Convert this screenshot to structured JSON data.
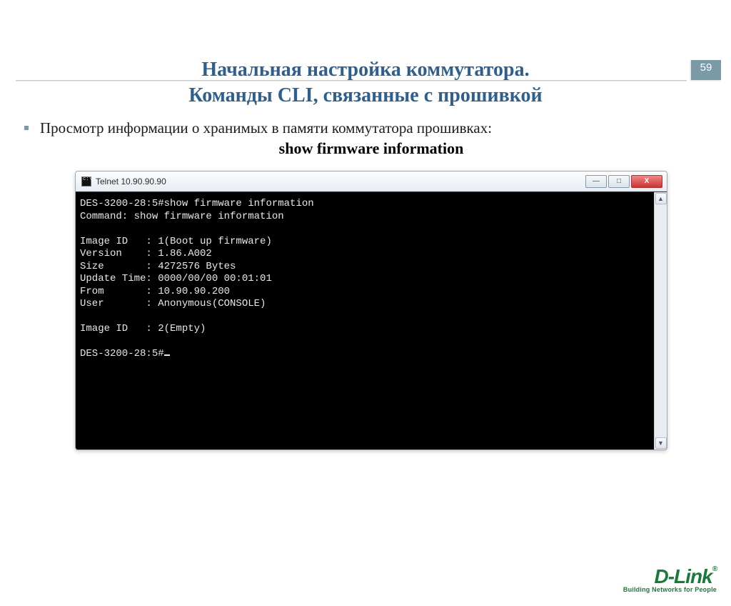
{
  "page_number": "59",
  "title_line1": "Начальная настройка коммутатора.",
  "title_line2": "Команды CLI, связанные с прошивкой",
  "bullet_text": "Просмотр информации о хранимых в памяти коммутатора прошивках:",
  "command": "show firmware information",
  "terminal": {
    "window_title": "Telnet 10.90.90.90",
    "lines": {
      "l1": "DES-3200-28:5#show firmware information",
      "l2": "Command: show firmware information",
      "blank1": "",
      "l3": "Image ID   : 1(Boot up firmware)",
      "l4": "Version    : 1.86.A002",
      "l5": "Size       : 4272576 Bytes",
      "l6": "Update Time: 0000/00/00 00:01:01",
      "l7": "From       : 10.90.90.200",
      "l8": "User       : Anonymous(CONSOLE)",
      "blank2": "",
      "l9": "Image ID   : 2(Empty)",
      "blank3": "",
      "prompt": "DES-3200-28:5#"
    }
  },
  "window_controls": {
    "minimize": "—",
    "maximize": "□",
    "close": "X"
  },
  "scroll": {
    "up": "▲",
    "down": "▼"
  },
  "brand": {
    "name": "D-Link",
    "reg": "®",
    "tagline": "Building Networks for People"
  }
}
